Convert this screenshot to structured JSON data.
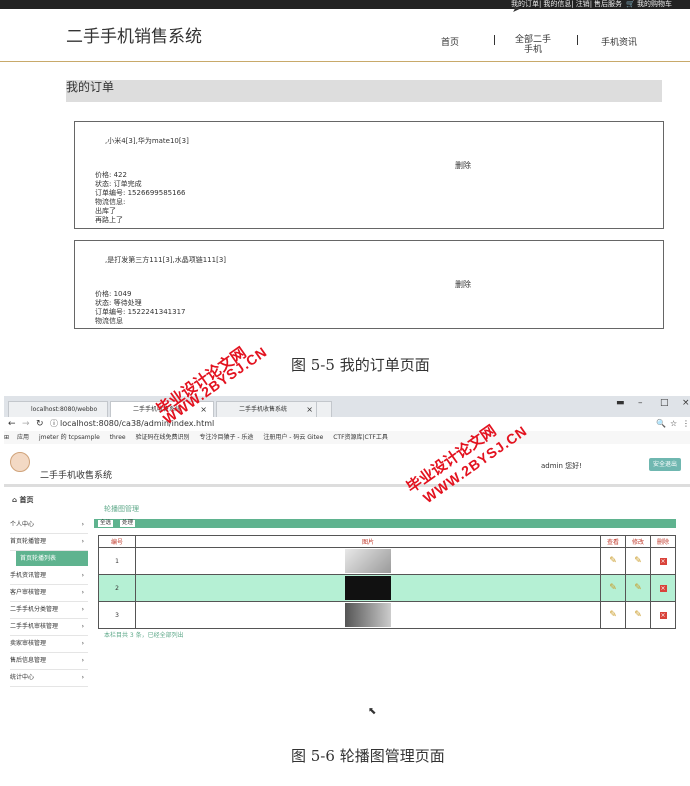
{
  "topbar": {
    "links": [
      "我的订单",
      "我的信息",
      "注销",
      "售后服务",
      "我的购物车"
    ]
  },
  "site": {
    "brand": "二手手机销售系统",
    "nav": [
      "首页",
      "全部二手",
      "手机",
      "手机资讯"
    ]
  },
  "orders": {
    "title": "我的订单",
    "items": [
      {
        "products": ",小米4[3],华为mate10[3]",
        "delete_label": "删除",
        "price": "价格: 422",
        "status": "状态: 订单完成",
        "order_no": "订单编号: 1526699585166",
        "logistics_label": "物流信息:",
        "logistics_lines": [
          "出库了",
          "再路上了"
        ]
      },
      {
        "products": ",是打发第三方111[3],水晶项链111[3]",
        "delete_label": "删除",
        "price": "价格: 1049",
        "status": "状态: 等待处理",
        "order_no": "订单编号: 1522241341317",
        "logistics_label": "物流信息"
      }
    ]
  },
  "captions": {
    "fig1": "图 5-5 我的订单页面",
    "fig2": "图 5-6 轮播图管理页面"
  },
  "watermark": {
    "line1": "毕业设计论文网",
    "line2": "WWW.2BYSJ.CN"
  },
  "browser": {
    "tabs": [
      "localhost:8080/webbo",
      "二手手机收售系统",
      "二手手机收售系统"
    ],
    "url": "localhost:8080/ca38/admin/index.html",
    "bookmarks": [
      "应用",
      "jmeter 的 tcpsample",
      "three",
      "验证码在线免费识别",
      "专注冷目猿子 - 乐途",
      "注册用户 - 码云 Gitee",
      "CTF资源库|CTF工具"
    ]
  },
  "admin": {
    "title": "二手手机收售系统",
    "greeting": "admin 您好!",
    "logout": "安全退出",
    "sidebar_home": "首页",
    "sidebar": [
      "个人中心",
      "首页轮播管理",
      "首页轮播列表",
      "手机资讯管理",
      "客户审核管理",
      "二手手机分类管理",
      "二手手机审核管理",
      "卖家审核管理",
      "售后信息管理",
      "统计中心"
    ],
    "breadcrumb": "轮播图管理",
    "toolbar": [
      "全选",
      "处理"
    ],
    "table_headers": [
      "编号",
      "图片",
      "查看",
      "修改",
      "删除"
    ],
    "rows": [
      "1",
      "2",
      "3"
    ],
    "footer": "本栏目共 3 条，已经全部列出"
  }
}
